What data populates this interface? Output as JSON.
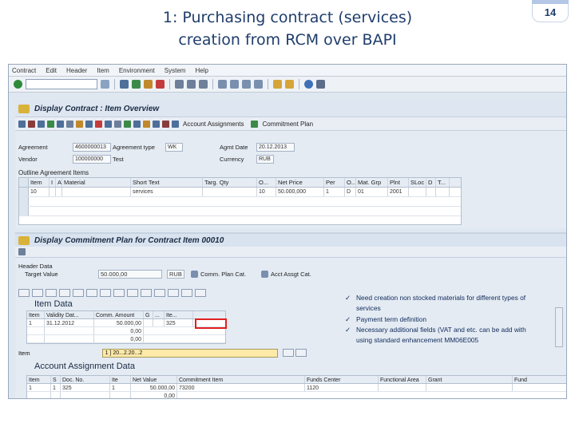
{
  "slide": {
    "title_line1": "1: Purchasing contract (services)",
    "title_line2": "creation from RCM over BAPI",
    "page_number": "14"
  },
  "menu": [
    "Contract",
    "Edit",
    "Header",
    "Item",
    "Environment",
    "System",
    "Help"
  ],
  "screen1": {
    "title": "Display Contract : Item Overview",
    "app_buttons": {
      "account_assignments": "Account Assignments",
      "commitment_plan": "Commitment Plan"
    },
    "header": {
      "agreement_label": "Agreement",
      "agreement_value": "4600000013",
      "agreement_type_label": "Agreement type",
      "agreement_type_value": "WK",
      "agmt_date_label": "Agmt Date",
      "agmt_date_value": "20.12.2013",
      "vendor_label": "Vendor",
      "vendor_value": "100000000",
      "vendor_name": "Test",
      "currency_label": "Currency",
      "currency_value": "RUB"
    },
    "outline_label": "Outline Agreement Items",
    "grid": {
      "columns": [
        "Item",
        "I",
        "A",
        "Material",
        "Short Text",
        "Targ. Qty",
        "O...",
        "Net Price",
        "Per",
        "O...",
        "Mat. Grp",
        "Plnt",
        "SLoc",
        "D",
        "T..."
      ],
      "rows": [
        [
          "10",
          "",
          "",
          "",
          "services",
          "",
          "10",
          "50.000,000",
          "1",
          "D",
          "01",
          "2001",
          "",
          "",
          ""
        ]
      ]
    }
  },
  "screen2": {
    "title": "Display Commitment Plan for Contract Item 00010",
    "subheader": "Header Data",
    "target_value_label": "Target Value",
    "target_value": "50.000,00",
    "target_currency": "RUB",
    "comm_plan_cat_label": "Comm. Plan Cat.",
    "acct_assgt_cat_label": "Acct Assgt Cat.",
    "item_data_title": "Item Data",
    "item_grid": {
      "columns": [
        "Item",
        "Validity Dat...",
        "Comm. Amount",
        "G",
        "...",
        "Ite..."
      ],
      "rows": [
        [
          "1",
          "31.12.2012",
          "50.000,00",
          "",
          "",
          "325"
        ],
        [
          "",
          "",
          "0,00",
          "",
          "",
          ""
        ],
        [
          "",
          "",
          "0,00",
          "",
          "",
          ""
        ],
        [
          "",
          "",
          "0,00",
          "",
          "",
          ""
        ]
      ]
    },
    "item_label": "Item",
    "item_field": "1 ] 20...2.20...2",
    "account_title": "Account Assignment Data",
    "account_grid": {
      "columns": [
        "Item",
        "S",
        "Doc. No.",
        "Ite",
        "Net Value",
        "Commitment Item",
        "Funds Center",
        "Functional Area",
        "Grant",
        "Fund"
      ],
      "rows": [
        [
          "1",
          "1",
          "325",
          "1",
          "50.000,00",
          "73200",
          "1120",
          "",
          "",
          ""
        ],
        [
          "",
          "",
          "",
          "",
          "0,00",
          "",
          "",
          "",
          "",
          ""
        ]
      ]
    }
  },
  "notes": [
    "Need creation non stocked materials for different types of services",
    "Payment term definition",
    "Necessary additional fields (VAT and etc. can be add with using standard enhancement MM06E005"
  ],
  "colors": {
    "accent": "#1f3d6b",
    "highlight_box": "#e02020",
    "item_field": "#fde9a8"
  }
}
